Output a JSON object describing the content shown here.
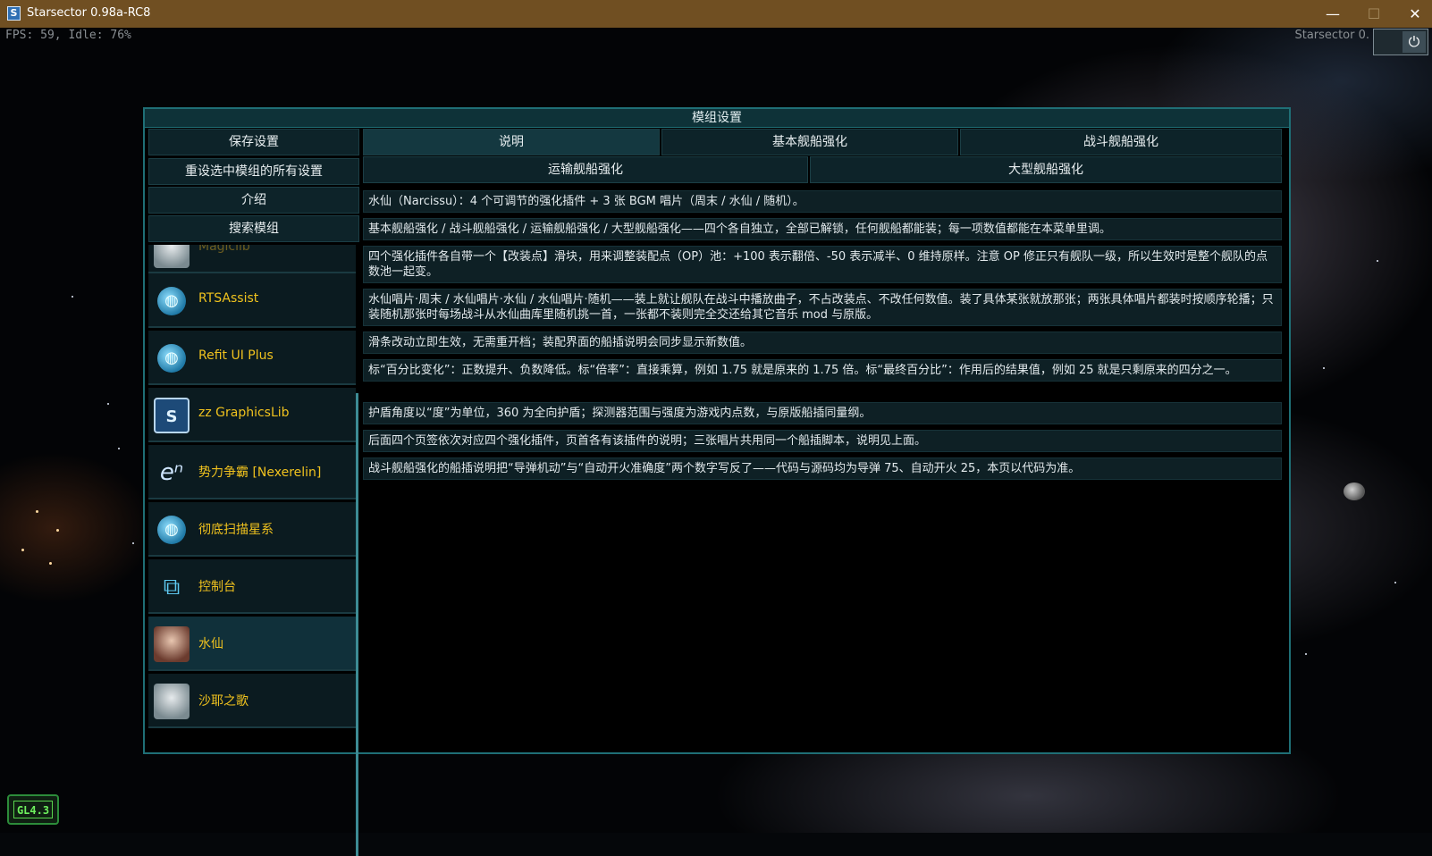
{
  "window": {
    "title": "Starsector 0.98a-RC8",
    "app_icon": "S",
    "minimize": "—",
    "maximize": "☐",
    "close": "✕"
  },
  "hud": {
    "fps": "FPS: 59, Idle: 76%",
    "version": "Starsector 0.",
    "gl_badge": "GL4.3"
  },
  "dialog": {
    "title": "模组设置",
    "left_buttons": [
      "保存设置",
      "重设选中模组的所有设置",
      "介绍",
      "搜索模组"
    ],
    "mods": [
      {
        "name": "Magiclib",
        "icon": "partial-icon"
      },
      {
        "name": "RTSAssist",
        "icon": "globe-icon"
      },
      {
        "name": "Refit UI Plus",
        "icon": "globe-icon"
      },
      {
        "name": "zz GraphicsLib",
        "icon": "graphicslib-icon"
      },
      {
        "name": "势力争霸 [Nexerelin]",
        "icon": "nexerelin-icon"
      },
      {
        "name": "彻底扫描星系",
        "icon": "globe-icon"
      },
      {
        "name": "控制台",
        "icon": "console-icon"
      },
      {
        "name": "水仙",
        "icon": "narcissu-avatar-icon",
        "selected": true
      },
      {
        "name": "沙耶之歌",
        "icon": "saya-avatar-icon"
      }
    ],
    "tabs_row1": [
      "说明",
      "基本舰船强化",
      "战斗舰船强化"
    ],
    "tabs_row2": [
      "运输舰船强化",
      "大型舰船强化"
    ],
    "active_tab": "说明",
    "lines": [
      "水仙（Narcissu）：4 个可调节的强化插件 + 3 张 BGM 唱片（周末 / 水仙 / 随机）。",
      "基本舰船强化 / 战斗舰船强化 / 运输舰船强化 / 大型舰船强化——四个各自独立，全部已解锁，任何舰船都能装；每一项数值都能在本菜单里调。",
      "四个强化插件各自带一个【改装点】滑块，用来调整装配点（OP）池：+100 表示翻倍、-50 表示减半、0 维持原样。注意 OP 修正只有舰队一级，所以生效时是整个舰队的点数池一起变。",
      "水仙唱片·周末 / 水仙唱片·水仙 / 水仙唱片·随机——装上就让舰队在战斗中播放曲子，不占改装点、不改任何数值。装了具体某张就放那张；两张具体唱片都装时按顺序轮播；只装随机那张时每场战斗从水仙曲库里随机挑一首，一张都不装则完全交还给其它音乐 mod 与原版。",
      "滑条改动立即生效，无需重开档；装配界面的船插说明会同步显示新数值。",
      "标“百分比变化”：正数提升、负数降低。标“倍率”：直接乘算，例如 1.75 就是原来的 1.75 倍。标“最终百分比”：作用后的结果值，例如 25 就是只剩原来的四分之一。",
      "护盾角度以“度”为单位，360 为全向护盾；探测器范围与强度为游戏内点数，与原版船插同量纲。",
      "后面四个页签依次对应四个强化插件，页首各有该插件的说明；三张唱片共用同一个船插脚本，说明见上面。",
      "战斗舰船强化的船插说明把“导弹机动”与“自动开火准确度”两个数字写反了——代码与源码均为导弹 75、自动开火 25，本页以代码为准。"
    ]
  },
  "colors": {
    "accent": "#1f6f76",
    "mod_name": "#f0c21e",
    "titlebar": "#704f22"
  }
}
